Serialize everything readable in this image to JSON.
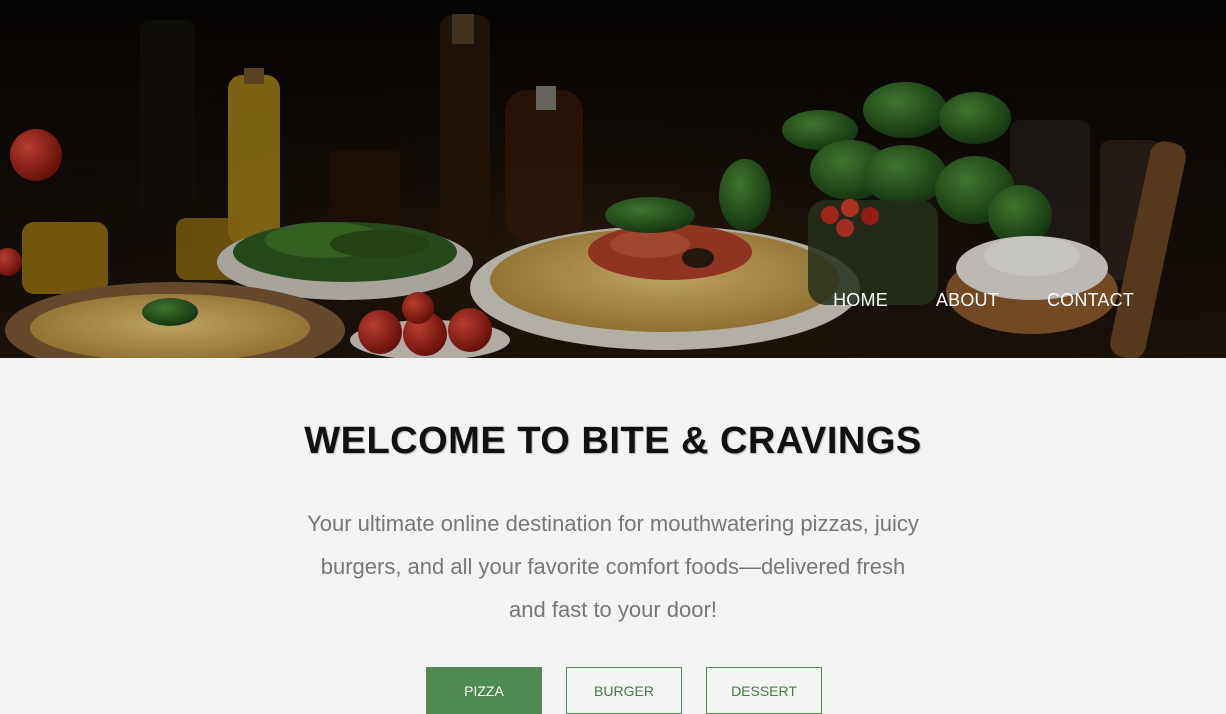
{
  "nav": {
    "items": [
      {
        "label": "HOME"
      },
      {
        "label": "ABOUT"
      },
      {
        "label": "CONTACT"
      }
    ]
  },
  "main": {
    "title": "WELCOME TO BITE & CRAVINGS",
    "tagline_lines": [
      "Your ultimate online destination for mouthwatering pizzas, juicy",
      "burgers, and all your favorite comfort foods—delivered fresh",
      "and fast to your door!"
    ]
  },
  "category_tabs": {
    "items": [
      {
        "label": "PIZZA",
        "active": true
      },
      {
        "label": "BURGER",
        "active": false
      },
      {
        "label": "DESSERT",
        "active": false
      }
    ]
  },
  "colors": {
    "accent": "#4e8a52",
    "page_bg": "#f4f4f4",
    "title": "#111111",
    "tagline": "#777777"
  }
}
